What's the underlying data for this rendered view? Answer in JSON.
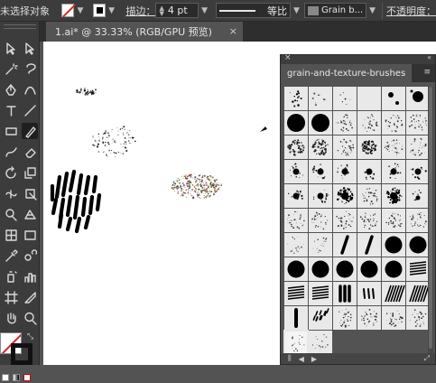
{
  "controlbar": {
    "selection_status": "未选择对象",
    "stroke_label": "描边：",
    "stroke_weight": "4 pt",
    "profile_label": "等比",
    "brush_name": "Grain b...",
    "opacity_label": "不透明度："
  },
  "document_tab": {
    "title": "1.ai* @ 33.33% (RGB/GPU 预览)",
    "close_glyph": "×"
  },
  "panel": {
    "title": "grain-and-texture-brushes",
    "close_glyph": "×",
    "collapse_glyph": "«",
    "menu_glyph": "≡",
    "brushes": [
      "scatter-dots",
      "scatter-dots-light",
      "scatter-dots-sparse",
      "blank",
      "dot-pair",
      "big-dot",
      "solid-blob",
      "solid-blob",
      "grain",
      "grain",
      "grain",
      "grain",
      "grain-cloud",
      "grain-cloud",
      "grain",
      "grain-dense",
      "grain",
      "grain",
      "splat",
      "splat",
      "splat",
      "splat",
      "splat",
      "splat",
      "splat",
      "splat",
      "grain-burst",
      "grain",
      "grain-burst",
      "splat-small",
      "grain",
      "grain",
      "grain",
      "grain",
      "grain",
      "grain",
      "grain-light",
      "grain-light",
      "stroke-diag",
      "stroke-diag",
      "solid-circle",
      "solid-circle",
      "solid-circle",
      "solid-circle",
      "solid-circle",
      "solid-circle",
      "solid-circle",
      "hatch",
      "hatch",
      "hatch",
      "bars",
      "dashes",
      "hatch-cross",
      "hatch-cross",
      "bar-vertical",
      "dashes-cluster",
      "grain",
      "grain",
      "grain",
      "grain",
      "grain-light",
      "grain-light"
    ],
    "selected_index": 60
  },
  "toolbar": {
    "tools": [
      "selection-tool",
      "direct-selection-tool",
      "magic-wand-tool",
      "lasso-tool",
      "pen-tool",
      "curvature-tool",
      "type-tool",
      "line-tool",
      "rectangle-tool",
      "paintbrush-tool",
      "shaper-tool",
      "eraser-tool",
      "rotate-tool",
      "scale-tool",
      "width-tool",
      "free-transform-tool",
      "shape-builder-tool",
      "perspective-grid-tool",
      "mesh-tool",
      "gradient-tool",
      "eyedropper-tool",
      "blend-tool",
      "symbol-sprayer-tool",
      "column-graph-tool",
      "artboard-tool",
      "slice-tool",
      "hand-tool",
      "zoom-tool"
    ],
    "active_tool": "paintbrush-tool"
  },
  "colors": {
    "app_bg": "#535353",
    "bar_bg": "#3c3c3c",
    "artboard": "#ffffff",
    "no_fill_slash": "#e02020"
  }
}
